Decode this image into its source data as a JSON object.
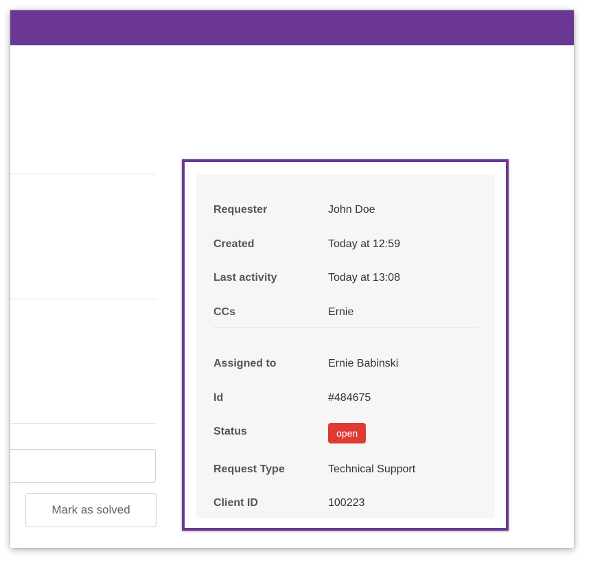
{
  "actions": {
    "mark_solved_label": "Mark as solved"
  },
  "details": {
    "requester": {
      "label": "Requester",
      "value": "John Doe"
    },
    "created": {
      "label": "Created",
      "value": "Today at 12:59"
    },
    "last_activity": {
      "label": "Last activity",
      "value": "Today at 13:08"
    },
    "ccs": {
      "label": "CCs",
      "value": "Ernie"
    },
    "assigned_to": {
      "label": "Assigned to",
      "value": "Ernie Babinski"
    },
    "id": {
      "label": "Id",
      "value": "#484675"
    },
    "status": {
      "label": "Status",
      "value": "open"
    },
    "request_type": {
      "label": "Request Type",
      "value": "Technical Support"
    },
    "client_id": {
      "label": "Client ID",
      "value": "100223"
    }
  },
  "colors": {
    "brand": "#6a3792",
    "status_open": "#e03a34",
    "panel_background": "#f6f6f6"
  }
}
